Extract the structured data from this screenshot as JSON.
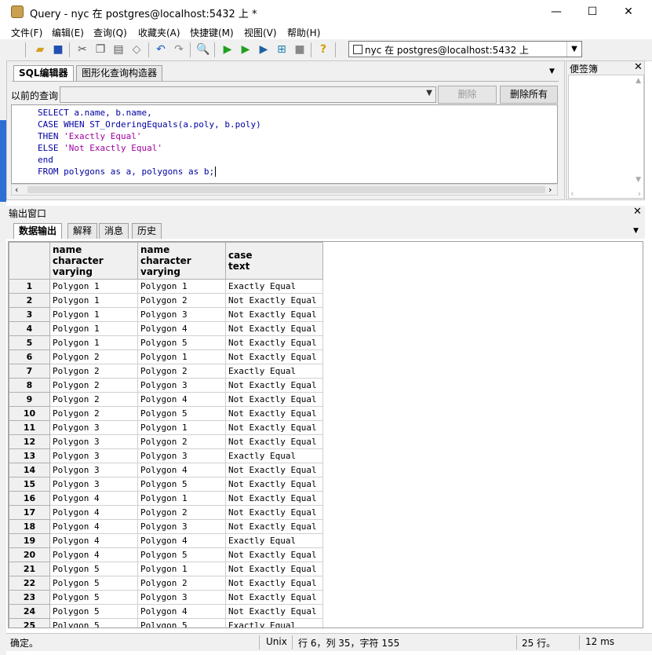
{
  "window": {
    "title": "Query - nyc 在  postgres@localhost:5432 上 *",
    "minimize": "—",
    "maximize": "☐",
    "close": "✕"
  },
  "menu": [
    "文件(F)",
    "编辑(E)",
    "查询(Q)",
    "收藏夹(A)",
    "快捷键(M)",
    "视图(V)",
    "帮助(H)"
  ],
  "toolbar": {
    "connection": "nyc 在  postgres@localhost:5432 上"
  },
  "editor": {
    "tabs": [
      "SQL编辑器",
      "图形化查询构造器"
    ],
    "prev_query_label": "以前的查询",
    "delete_label": "删除",
    "delete_all_label": "删除所有",
    "lines": [
      {
        "code": "SELECT a.name, b.name,",
        "str": "",
        "tail": ""
      },
      {
        "code": "CASE WHEN ST_OrderingEquals(a.poly, b.poly)",
        "str": "",
        "tail": ""
      },
      {
        "code": "THEN ",
        "str": "'Exactly Equal'",
        "tail": ""
      },
      {
        "code": "ELSE ",
        "str": "'Not Exactly Equal'",
        "tail": ""
      },
      {
        "code": "end",
        "str": "",
        "tail": ""
      },
      {
        "code": "FROM polygons as a, polygons as b;",
        "str": "",
        "tail": ""
      }
    ]
  },
  "notepad": {
    "title": "便签簿"
  },
  "output": {
    "title": "输出窗口",
    "tabs": [
      "数据输出",
      "解释",
      "消息",
      "历史"
    ],
    "columns": [
      {
        "name": "name",
        "type": "character varying"
      },
      {
        "name": "name",
        "type": "character varying"
      },
      {
        "name": "case",
        "type": "text"
      }
    ],
    "rows": [
      [
        "1",
        "Polygon 1",
        "Polygon 1",
        "Exactly Equal"
      ],
      [
        "2",
        "Polygon 1",
        "Polygon 2",
        "Not Exactly Equal"
      ],
      [
        "3",
        "Polygon 1",
        "Polygon 3",
        "Not Exactly Equal"
      ],
      [
        "4",
        "Polygon 1",
        "Polygon 4",
        "Not Exactly Equal"
      ],
      [
        "5",
        "Polygon 1",
        "Polygon 5",
        "Not Exactly Equal"
      ],
      [
        "6",
        "Polygon 2",
        "Polygon 1",
        "Not Exactly Equal"
      ],
      [
        "7",
        "Polygon 2",
        "Polygon 2",
        "Exactly Equal"
      ],
      [
        "8",
        "Polygon 2",
        "Polygon 3",
        "Not Exactly Equal"
      ],
      [
        "9",
        "Polygon 2",
        "Polygon 4",
        "Not Exactly Equal"
      ],
      [
        "10",
        "Polygon 2",
        "Polygon 5",
        "Not Exactly Equal"
      ],
      [
        "11",
        "Polygon 3",
        "Polygon 1",
        "Not Exactly Equal"
      ],
      [
        "12",
        "Polygon 3",
        "Polygon 2",
        "Not Exactly Equal"
      ],
      [
        "13",
        "Polygon 3",
        "Polygon 3",
        "Exactly Equal"
      ],
      [
        "14",
        "Polygon 3",
        "Polygon 4",
        "Not Exactly Equal"
      ],
      [
        "15",
        "Polygon 3",
        "Polygon 5",
        "Not Exactly Equal"
      ],
      [
        "16",
        "Polygon 4",
        "Polygon 1",
        "Not Exactly Equal"
      ],
      [
        "17",
        "Polygon 4",
        "Polygon 2",
        "Not Exactly Equal"
      ],
      [
        "18",
        "Polygon 4",
        "Polygon 3",
        "Not Exactly Equal"
      ],
      [
        "19",
        "Polygon 4",
        "Polygon 4",
        "Exactly Equal"
      ],
      [
        "20",
        "Polygon 4",
        "Polygon 5",
        "Not Exactly Equal"
      ],
      [
        "21",
        "Polygon 5",
        "Polygon 1",
        "Not Exactly Equal"
      ],
      [
        "22",
        "Polygon 5",
        "Polygon 2",
        "Not Exactly Equal"
      ],
      [
        "23",
        "Polygon 5",
        "Polygon 3",
        "Not Exactly Equal"
      ],
      [
        "24",
        "Polygon 5",
        "Polygon 4",
        "Not Exactly Equal"
      ],
      [
        "25",
        "Polygon 5",
        "Polygon 5",
        "Exactly Equal"
      ]
    ]
  },
  "status": {
    "message": "确定。",
    "encoding": "Unix",
    "position": "行 6，列 35，字符 155",
    "row_count": "25 行。",
    "time": "12 ms"
  }
}
